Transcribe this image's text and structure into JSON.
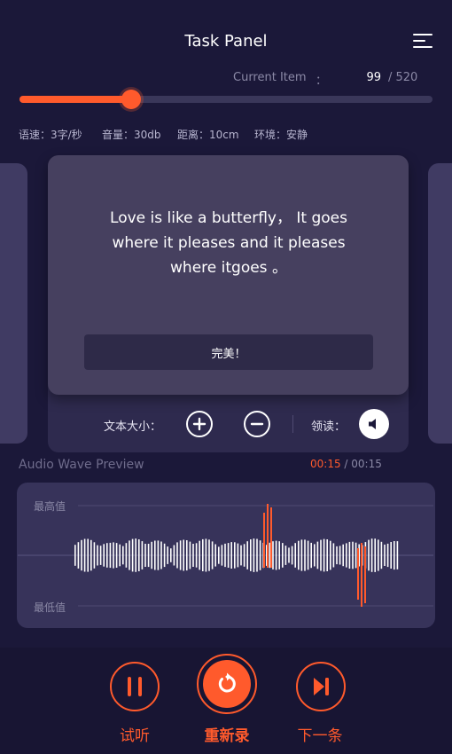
{
  "header": {
    "title": "Task Panel",
    "menu_icon": "menu-icon"
  },
  "progress": {
    "current_label": "Current Item",
    "colon": "：",
    "current": "99",
    "total": "/ 520",
    "fraction": 0.27
  },
  "stats": {
    "speed": "语速：3字/秒",
    "volume": "音量：30db",
    "distance": "距离：10cm",
    "environment": "环境：安静"
  },
  "card": {
    "sentence_lines": [
      "Love is like a butterfly， It goes",
      "where it pleases and it pleases",
      "where itgoes 。"
    ],
    "result_label": "完美！",
    "text_size_label": "文本大小：",
    "read_label": "领读：",
    "icons": {
      "increase": "plus-icon",
      "decrease": "minus-icon",
      "read": "speaker-icon"
    }
  },
  "audio": {
    "title": "Audio Wave Preview",
    "current_time": "00:15",
    "total_time": "/ 00:15",
    "max_label": "最高值",
    "min_label": "最低值"
  },
  "controls": {
    "listen_label": "试听",
    "rerecord_label": "重新录",
    "next_label": "下一条",
    "icons": {
      "listen": "pause-icon",
      "rerecord": "refresh-icon",
      "next": "skip-next-icon"
    }
  },
  "colors": {
    "background": "#1b1839",
    "accent": "#ff5a2c",
    "card": "#46405f",
    "muted_text": "#8b89a6"
  }
}
